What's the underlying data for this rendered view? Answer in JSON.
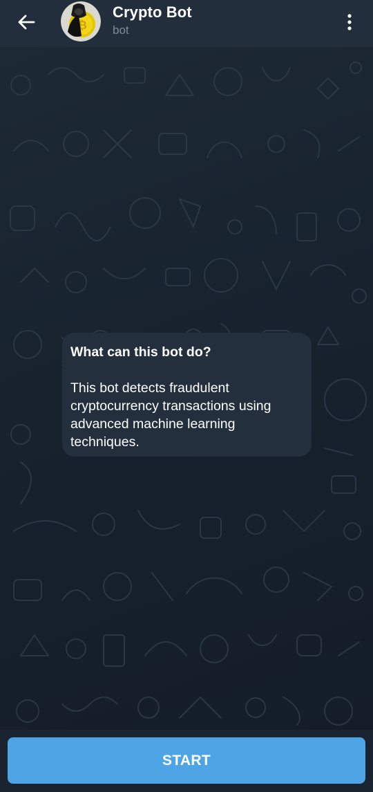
{
  "header": {
    "title": "Crypto Bot",
    "subtitle": "bot",
    "back_icon": "arrow-left-icon",
    "menu_icon": "more-vertical-icon",
    "avatar_icon": "hooded-figure-bitcoin-avatar"
  },
  "chat": {
    "bubble": {
      "title": "What can this bot do?",
      "text": "This bot detects fraudulent cryptocurrency transactions using advanced machine learning techniques."
    }
  },
  "footer": {
    "start_label": "START"
  },
  "colors": {
    "header_bg": "#232e3c",
    "chat_bg": "#17212b",
    "bubble_bg": "#242f3d",
    "accent": "#4fa4e6",
    "subtitle": "#7f8b98"
  }
}
